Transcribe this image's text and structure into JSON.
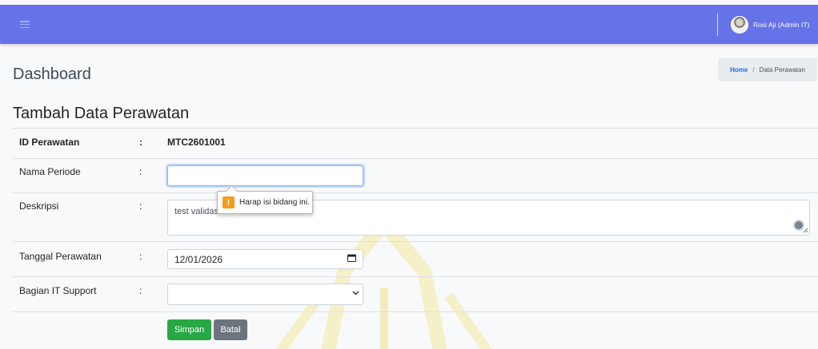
{
  "navbar": {
    "user_name": "Rosi Aji (Admin IT)"
  },
  "header": {
    "page_title": "Dashboard",
    "breadcrumb_home": "Home",
    "breadcrumb_sep": "/",
    "breadcrumb_current": "Data Perawatan"
  },
  "form": {
    "title": "Tambah Data Perawatan",
    "colon": ":",
    "id_label": "ID Perawatan",
    "id_value": "MTC2601001",
    "periode_label": "Nama Periode",
    "periode_value": "",
    "deskripsi_label": "Deskripsi",
    "deskripsi_value": "test validasi",
    "tanggal_label": "Tanggal Perawatan",
    "tanggal_value": "12/01/2026",
    "bagian_label": "Bagian IT Support",
    "bagian_value": "",
    "save_label": "Simpan",
    "cancel_label": "Batal"
  },
  "tooltip": {
    "icon_glyph": "!",
    "message": "Harap isi bidang ini."
  },
  "colors": {
    "navbar": "#6672e8",
    "save_button": "#28a745",
    "cancel_button": "#6c757d",
    "warning": "#f59c1a",
    "link": "#0d6efd"
  },
  "icons": [
    "hamburger-menu-icon",
    "avatar",
    "warning-icon",
    "calendar-icon",
    "chevron-down-icon",
    "resize-handle-icon",
    "grammar-assistant-icon"
  ]
}
